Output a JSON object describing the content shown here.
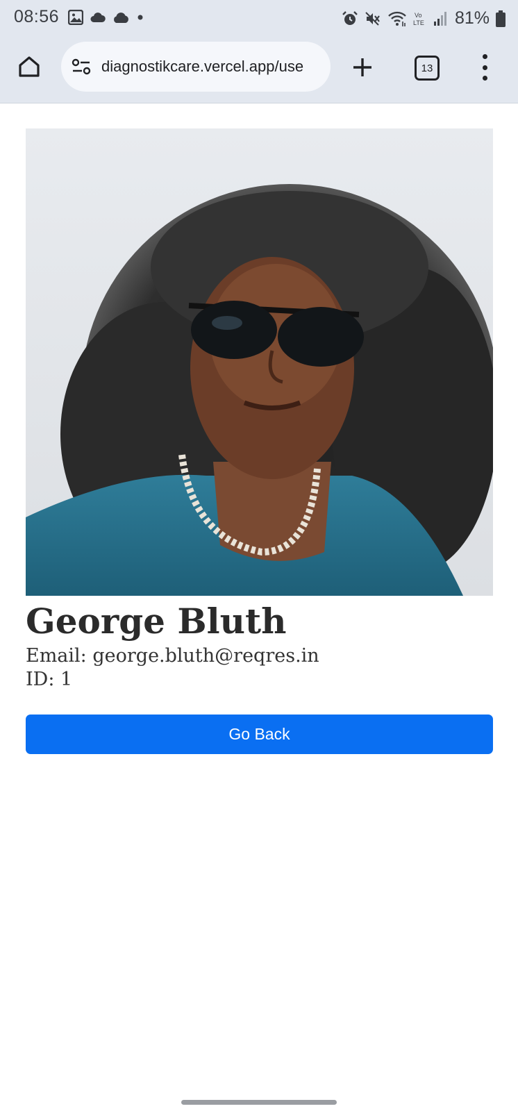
{
  "status_bar": {
    "time": "08:56",
    "battery_percent": "81%",
    "left_icons": [
      "image-icon",
      "cloud-icon",
      "cloud-icon",
      "dot-icon"
    ],
    "right_icons": [
      "alarm-icon",
      "mute-icon",
      "wifi-icon",
      "volte-icon",
      "signal-icon",
      "battery-icon"
    ]
  },
  "browser": {
    "url": "diagnostikcare.vercel.app/use",
    "tab_count": "13",
    "icons": {
      "home": "home-icon",
      "site_info": "site-settings-icon",
      "new_tab": "plus-icon",
      "menu": "more-vert-icon"
    }
  },
  "user": {
    "name": "George Bluth",
    "email_line": "Email: george.bluth@reqres.in",
    "id_line": "ID: 1"
  },
  "actions": {
    "go_back_label": "Go Back"
  },
  "colors": {
    "chrome_bg": "#e2e7ef",
    "button_blue": "#0a6ff2",
    "text_dark": "#2b2b2b"
  }
}
